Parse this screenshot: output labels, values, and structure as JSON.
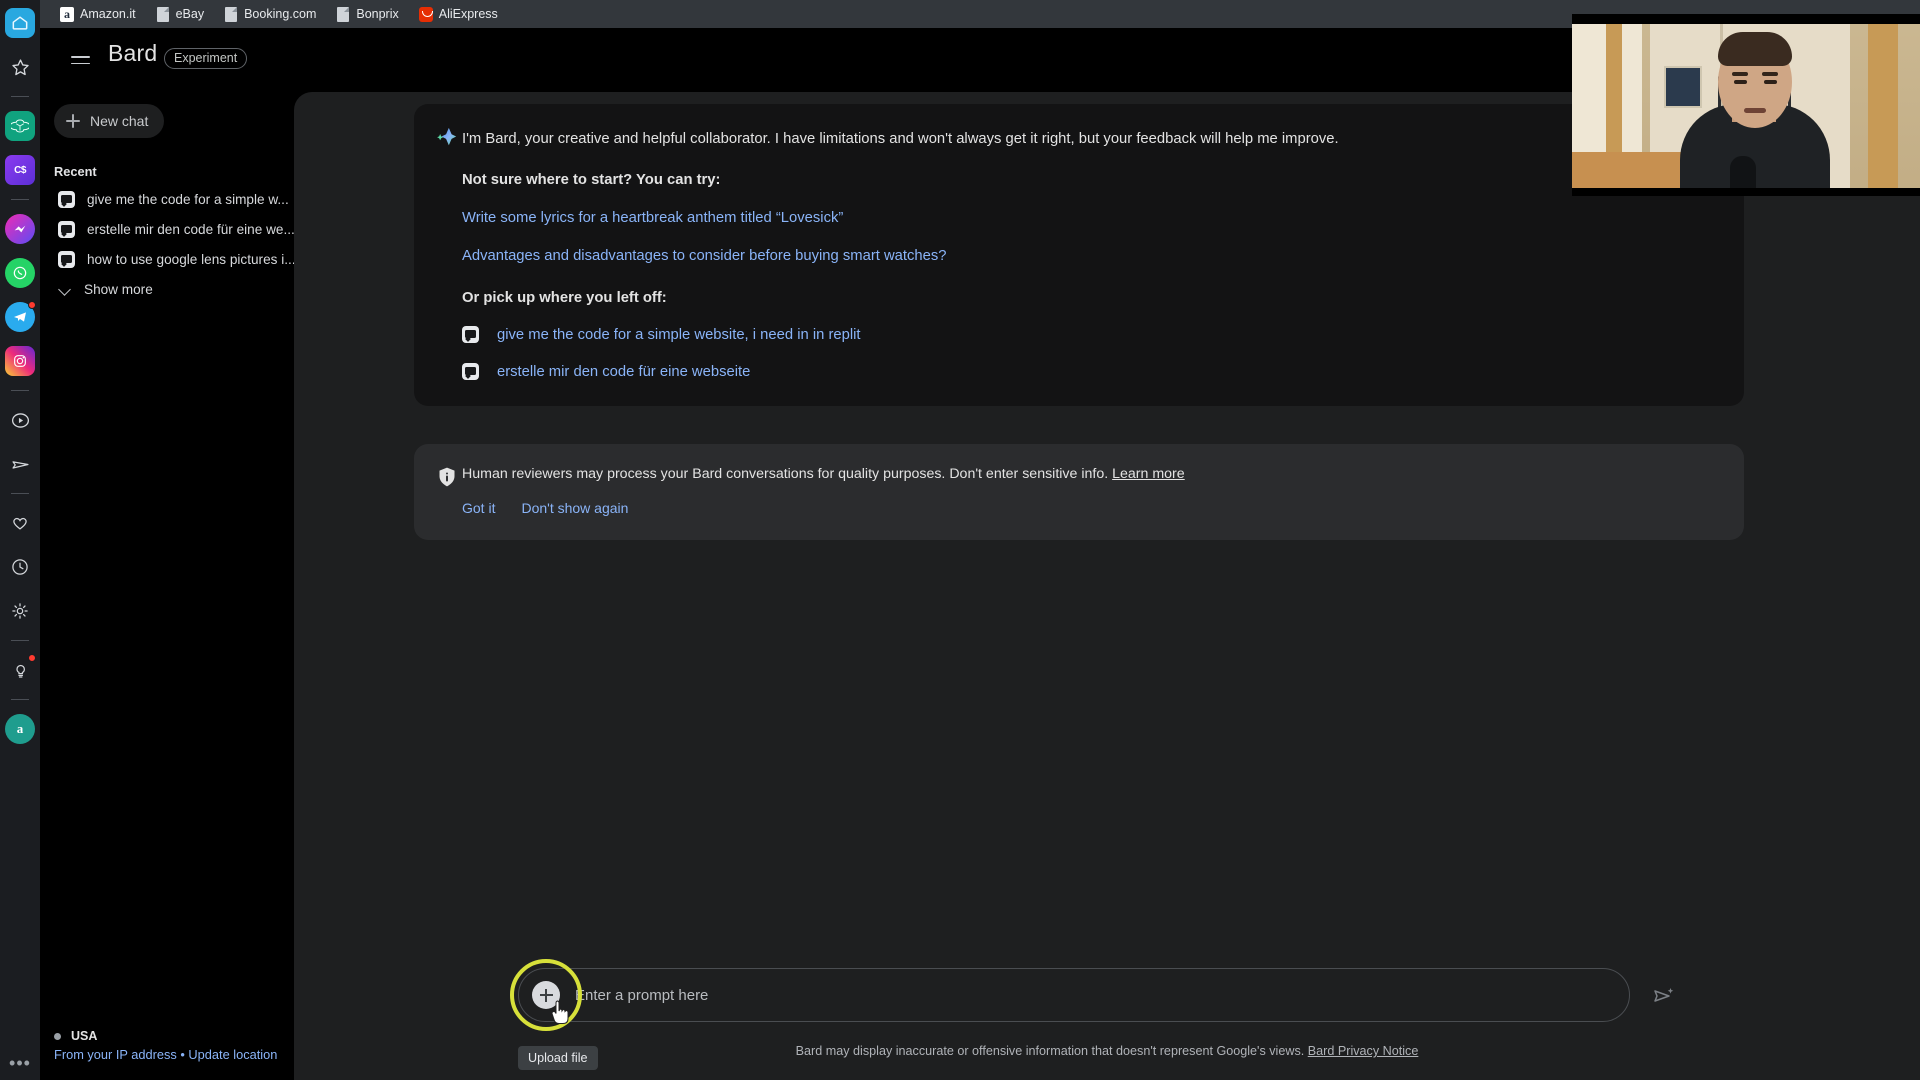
{
  "browser": {
    "bookmarks": [
      {
        "label": "Amazon.it",
        "icon": "amazon-icon"
      },
      {
        "label": "eBay",
        "icon": "page-icon"
      },
      {
        "label": "Booking.com",
        "icon": "page-icon"
      },
      {
        "label": "Bonprix",
        "icon": "page-icon"
      },
      {
        "label": "AliExpress",
        "icon": "aliexpress-icon"
      }
    ]
  },
  "rail": {
    "items": [
      {
        "name": "home-icon",
        "badge": false
      },
      {
        "name": "star-icon",
        "badge": false
      },
      {
        "name": "separator",
        "badge": false
      },
      {
        "name": "openai-icon",
        "badge": false
      },
      {
        "name": "cs-icon",
        "badge": false
      },
      {
        "name": "separator",
        "badge": false
      },
      {
        "name": "messenger-icon",
        "badge": false
      },
      {
        "name": "whatsapp-icon",
        "badge": false
      },
      {
        "name": "telegram-icon",
        "badge": true
      },
      {
        "name": "instagram-icon",
        "badge": false
      },
      {
        "name": "separator",
        "badge": false
      },
      {
        "name": "play-circle-icon",
        "badge": false
      },
      {
        "name": "send-icon",
        "badge": false
      },
      {
        "name": "separator",
        "badge": false
      },
      {
        "name": "heart-icon",
        "badge": false
      },
      {
        "name": "clock-icon",
        "badge": false
      },
      {
        "name": "gear-icon",
        "badge": false
      },
      {
        "name": "separator",
        "badge": false
      },
      {
        "name": "lightbulb-icon",
        "badge": true
      },
      {
        "name": "separator",
        "badge": false
      },
      {
        "name": "amazon-a-icon",
        "badge": false
      }
    ],
    "overflow": "•••"
  },
  "header": {
    "title": "Bard",
    "chip": "Experiment"
  },
  "sidebar": {
    "new_chat_label": "New chat",
    "recent_label": "Recent",
    "recent_items": [
      "give me the code for a simple w...",
      "erstelle mir den code für eine we...",
      "how to use google lens pictures i..."
    ],
    "show_more_label": "Show more",
    "location": {
      "country": "USA",
      "source": "From your IP address",
      "separator": "•",
      "update": "Update location"
    }
  },
  "main": {
    "intro": "I'm Bard, your creative and helpful collaborator. I have limitations and won't always get it right, but your feedback will help me improve.",
    "try_heading": "Not sure where to start? You can try:",
    "suggestions": [
      "Write some lyrics for a heartbreak anthem titled “Lovesick”",
      "Advantages and disadvantages to consider before buying smart watches?"
    ],
    "pick_heading": "Or pick up where you left off:",
    "history": [
      "give me the code for a simple website, i need in in replit",
      "erstelle mir den code für eine webseite"
    ],
    "notice": {
      "text": "Human reviewers may process your Bard conversations for quality purposes. Don't enter sensitive info. ",
      "link": "Learn more",
      "got_it": "Got it",
      "dont_show": "Don't show again"
    }
  },
  "prompt": {
    "placeholder": "Enter a prompt here",
    "value": "",
    "upload_tooltip": "Upload file",
    "footer_text": "Bard may display inaccurate or offensive information that doesn't represent Google's views. ",
    "footer_link": "Bard Privacy Notice"
  },
  "colors": {
    "accent_link": "#8ab4f8",
    "highlight_ring": "#d7e03a",
    "surface": "#1e1f20",
    "card": "#131314",
    "notice_card": "#2b2c2e"
  }
}
